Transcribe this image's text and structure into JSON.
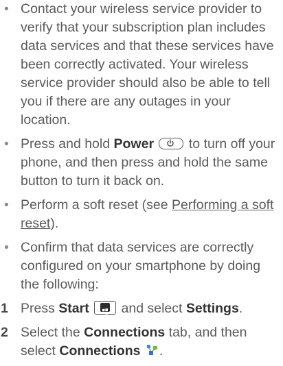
{
  "bullets": [
    {
      "text": "Contact your wireless service provider to verify that your subscription plan includes data services and that these services have been correctly activated. Your wireless service provider should also be able to tell you if there are any outages in your location."
    },
    {
      "pre": "Press and hold ",
      "bold": "Power",
      "post": " to turn off your phone, and then press and hold the same button to turn it back on."
    },
    {
      "pre": "Perform a soft reset (see ",
      "link": "Performing a soft reset",
      "post": ")."
    },
    {
      "text": "Confirm that data services are correctly configured on your smartphone by doing the following:"
    }
  ],
  "steps": [
    {
      "number": "1",
      "pre": "Press ",
      "bold1": "Start",
      "mid": " and select ",
      "bold2": "Settings",
      "post": "."
    },
    {
      "number": "2",
      "pre": "Select the ",
      "bold1": "Connections",
      "mid": " tab, and then select ",
      "bold2": "Connections",
      "post": "."
    }
  ],
  "bullet_glyph": "•",
  "icons": {
    "power": "power-icon",
    "start": "windows-start-icon",
    "connections": "connections-icon"
  }
}
